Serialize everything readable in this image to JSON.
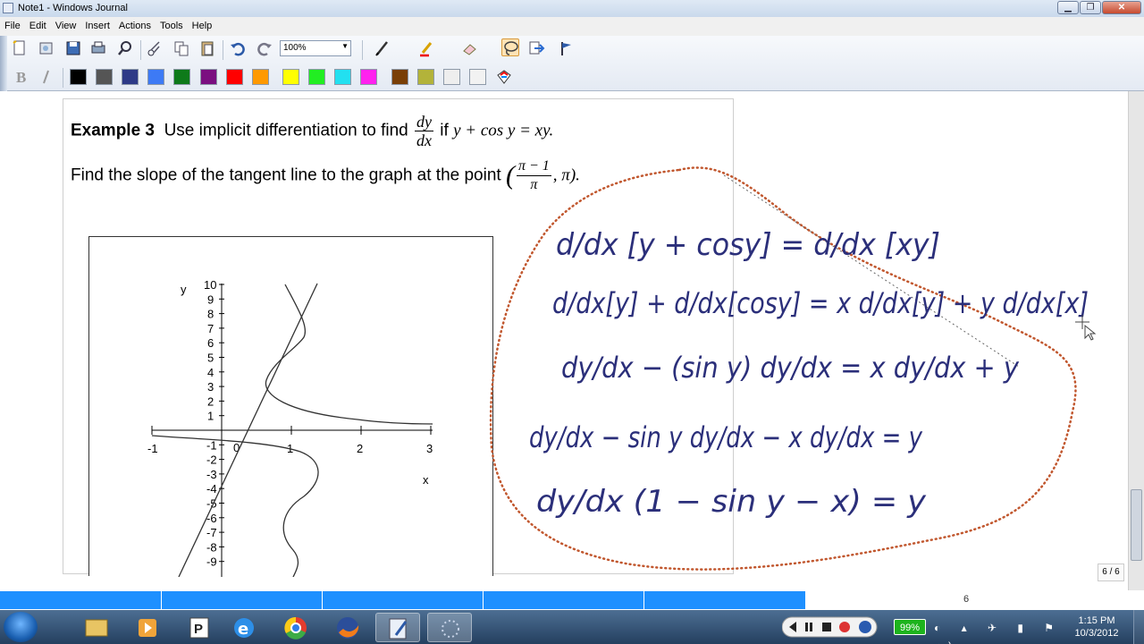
{
  "window": {
    "title": "Note1 - Windows Journal",
    "min": "▁",
    "max": "❐",
    "close": "✕"
  },
  "menu": [
    "File",
    "Edit",
    "View",
    "Insert",
    "Actions",
    "Tools",
    "Help"
  ],
  "toolbar": {
    "zoom_value": "100%"
  },
  "colors": {
    "swatches": [
      "#000000",
      "#555555",
      "#2e3a87",
      "#3d7af5",
      "#0e7a1a",
      "#7b0f80",
      "#ff0000",
      "#ff9900",
      "#ffff00",
      "#22ee22",
      "#22e0f0",
      "#ff22ee",
      "#7a3f06",
      "#b3b33a",
      "#eeeeee",
      "#f2f2f2"
    ]
  },
  "content": {
    "example_label": "Example 3",
    "example_text": "Use implicit differentiation to find",
    "dy": "dy",
    "dx": "dx",
    "if_word": "if",
    "equation": "y + cos y = xy.",
    "line2": "Find the slope of the tangent line to the graph at the point",
    "point_num": "π − 1",
    "point_den": "π",
    "point_y": ", π",
    "point_close": ")."
  },
  "graph": {
    "y_axis_label": "y",
    "x_axis_label": "x",
    "y_ticks_pos": [
      "10",
      "9",
      "8",
      "7",
      "6",
      "5",
      "4",
      "3",
      "2",
      "1"
    ],
    "y_ticks_neg": [
      "-1",
      "-2",
      "-3",
      "-4",
      "-5",
      "-6",
      "-7",
      "-8",
      "-9"
    ],
    "x_ticks": [
      "-1",
      "0",
      "1",
      "2",
      "3"
    ],
    "origin_label": "0"
  },
  "handwriting": {
    "line1": "d/dx [y + cosy] = d/dx [xy]",
    "line2": "d/dx[y] + d/dx[cosy] = x d/dx[y] + y d/dx[x]",
    "line3": "dy/dx − (sin y) dy/dx = x dy/dx + y",
    "line4": "dy/dx − sin y dy/dx − x dy/dx = y",
    "line5": "dy/dx (1 − sin y − x) = y"
  },
  "page_indicator": "6 / 6",
  "status": {
    "page_number": "6"
  },
  "taskbar": {
    "battery": "99%",
    "time": "1:15 PM",
    "date": "10/3/2012"
  }
}
